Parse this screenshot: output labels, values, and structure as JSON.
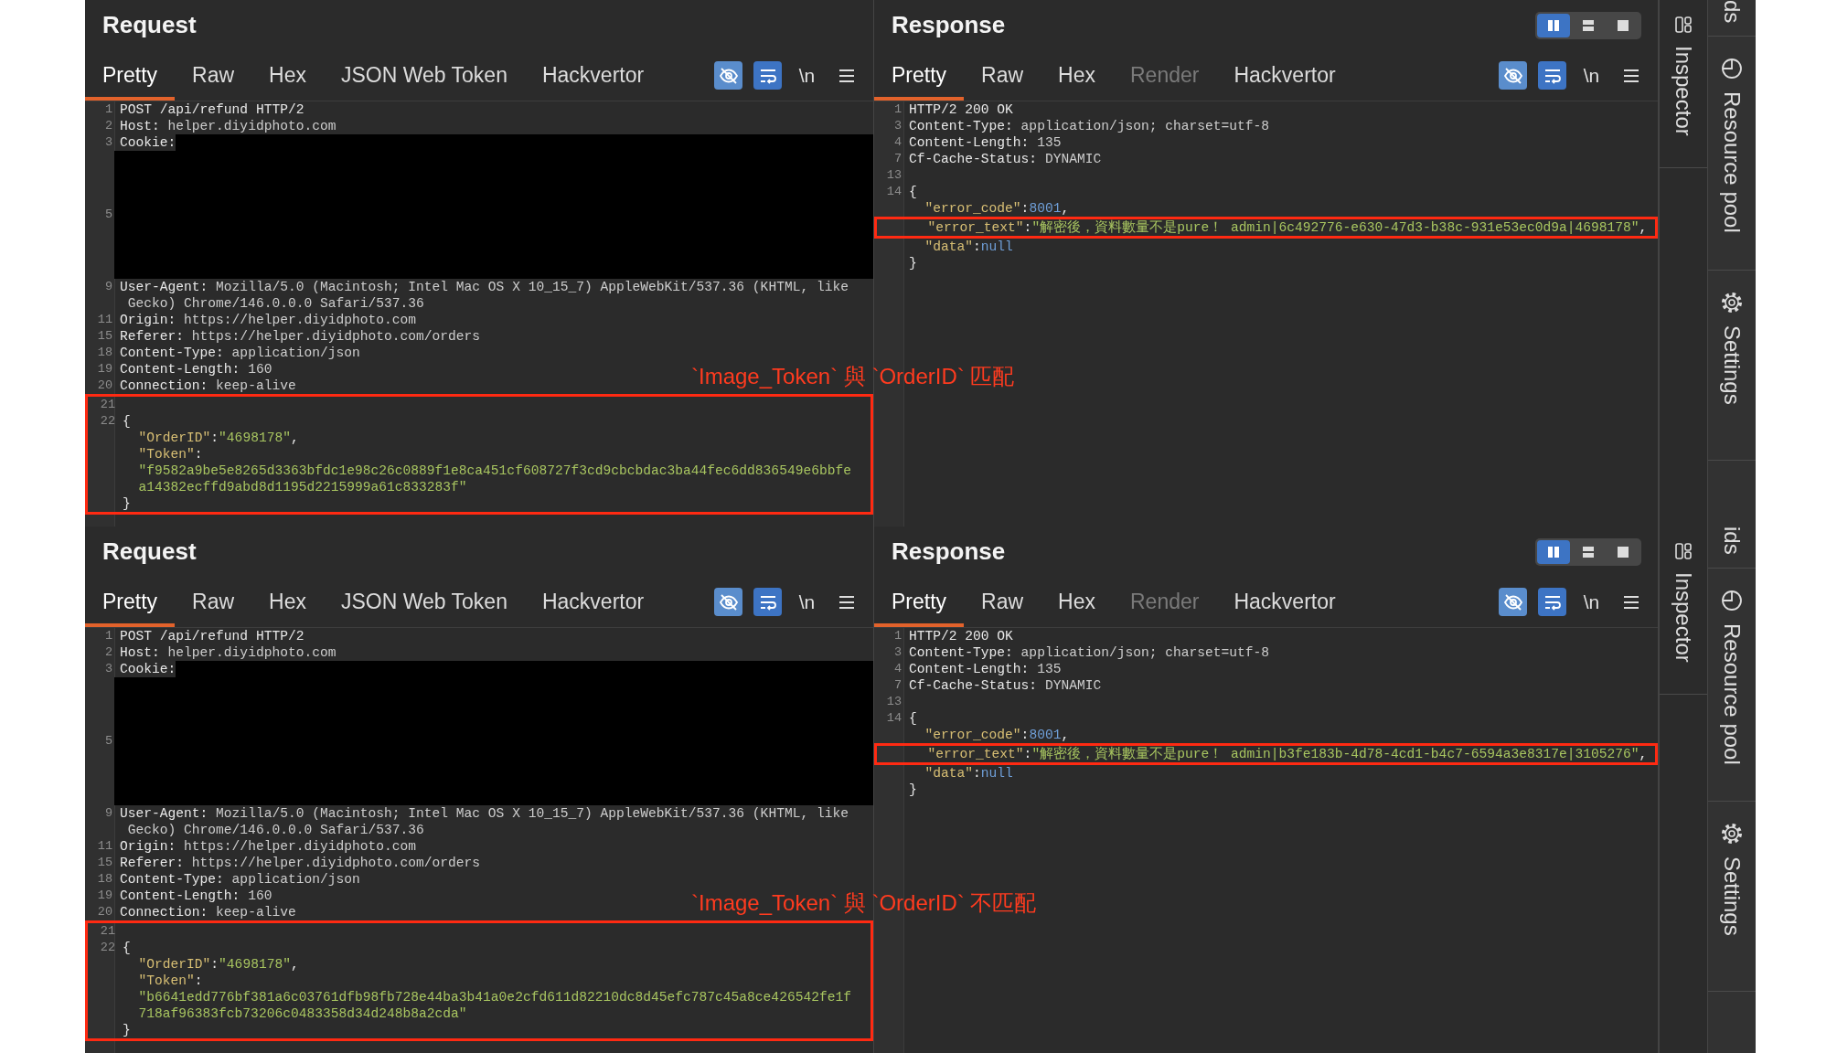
{
  "captures": [
    {
      "request": {
        "title": "Request",
        "tabs": [
          {
            "label": "Pretty",
            "selected": true,
            "disabled": false
          },
          {
            "label": "Raw",
            "selected": false,
            "disabled": false
          },
          {
            "label": "Hex",
            "selected": false,
            "disabled": false
          },
          {
            "label": "JSON Web Token",
            "selected": false,
            "disabled": false
          },
          {
            "label": "Hackvertor",
            "selected": false,
            "disabled": false
          }
        ],
        "toolbar": [
          {
            "kind": "hide",
            "on": true
          },
          {
            "kind": "wrap",
            "on": true
          },
          {
            "kind": "newline",
            "label": "\\n"
          },
          {
            "kind": "menu"
          }
        ],
        "blocks": [
          {
            "kind": "plain",
            "lines": [
              {
                "n": "1",
                "kind": "code",
                "segs": [
                  {
                    "kind": "plain",
                    "text": "POST /api/refund HTTP/2"
                  }
                ]
              },
              {
                "n": "2",
                "kind": "code",
                "segs": [
                  {
                    "kind": "name",
                    "text": "Host:"
                  },
                  {
                    "kind": "value",
                    "text": " helper.diyidphoto.com"
                  }
                ]
              },
              {
                "n": "3",
                "kind": "code-redacted",
                "segs": [
                  {
                    "kind": "name",
                    "text": "Cookie:"
                  }
                ]
              },
              {
                "n": "5",
                "kind": "redacted"
              },
              {
                "n": "9",
                "kind": "code",
                "segs": [
                  {
                    "kind": "name",
                    "text": "User-Agent:"
                  },
                  {
                    "kind": "value",
                    "text": " Mozilla/5.0 (Macintosh; Intel Mac OS X 10_15_7) AppleWebKit/537.36 (KHTML, like"
                  }
                ]
              },
              {
                "kind": "code",
                "segs": [
                  {
                    "kind": "value",
                    "text": " Gecko) Chrome/146.0.0.0 Safari/537.36"
                  }
                ]
              },
              {
                "n": "11",
                "kind": "code",
                "segs": [
                  {
                    "kind": "name",
                    "text": "Origin:"
                  },
                  {
                    "kind": "value",
                    "text": " https://helper.diyidphoto.com"
                  }
                ]
              },
              {
                "n": "15",
                "kind": "code",
                "segs": [
                  {
                    "kind": "name",
                    "text": "Referer:"
                  },
                  {
                    "kind": "value",
                    "text": " https://helper.diyidphoto.com/orders"
                  }
                ]
              },
              {
                "n": "18",
                "kind": "code",
                "segs": [
                  {
                    "kind": "name",
                    "text": "Content-Type:"
                  },
                  {
                    "kind": "value",
                    "text": " application/json"
                  }
                ]
              },
              {
                "n": "19",
                "kind": "code",
                "segs": [
                  {
                    "kind": "name",
                    "text": "Content-Length:"
                  },
                  {
                    "kind": "value",
                    "text": " 160"
                  }
                ]
              },
              {
                "n": "20",
                "kind": "code",
                "segs": [
                  {
                    "kind": "name",
                    "text": "Connection:"
                  },
                  {
                    "kind": "value",
                    "text": " keep-alive"
                  }
                ]
              }
            ]
          },
          {
            "kind": "boxed",
            "lines": [
              {
                "n": "21",
                "kind": "blank"
              },
              {
                "n": "22",
                "kind": "code",
                "segs": [
                  {
                    "kind": "punct",
                    "text": "{"
                  }
                ]
              },
              {
                "kind": "code",
                "segs": [
                  {
                    "kind": "key",
                    "text": "  \"OrderID\""
                  },
                  {
                    "kind": "punct",
                    "text": ":"
                  },
                  {
                    "kind": "string",
                    "text": "\"4698178\""
                  },
                  {
                    "kind": "punct",
                    "text": ","
                  }
                ]
              },
              {
                "kind": "code",
                "segs": [
                  {
                    "kind": "key",
                    "text": "  \"Token\""
                  },
                  {
                    "kind": "punct",
                    "text": ":"
                  }
                ]
              },
              {
                "kind": "code",
                "segs": [
                  {
                    "kind": "string",
                    "text": "  \"f9582a9be5e8265d3363bfdc1e98c26c0889f1e8ca451cf608727f3cd9cbcbdac3ba44fec6dd836549e6bbfe"
                  }
                ]
              },
              {
                "kind": "code",
                "segs": [
                  {
                    "kind": "string",
                    "text": "  a14382ecffd9abd8d1195d2215999a61c833283f\""
                  }
                ]
              },
              {
                "kind": "code",
                "segs": [
                  {
                    "kind": "punct",
                    "text": "}"
                  }
                ]
              }
            ]
          }
        ]
      },
      "response": {
        "title": "Response",
        "layout_buttons": [
          {
            "kind": "columns",
            "selected": true
          },
          {
            "kind": "rows",
            "selected": false
          },
          {
            "kind": "single",
            "selected": false
          }
        ],
        "tabs": [
          {
            "label": "Pretty",
            "selected": true,
            "disabled": false
          },
          {
            "label": "Raw",
            "selected": false,
            "disabled": false
          },
          {
            "label": "Hex",
            "selected": false,
            "disabled": false
          },
          {
            "label": "Render",
            "selected": false,
            "disabled": true
          },
          {
            "label": "Hackvertor",
            "selected": false,
            "disabled": false
          }
        ],
        "toolbar": [
          {
            "kind": "hide",
            "on": true
          },
          {
            "kind": "wrap",
            "on": true
          },
          {
            "kind": "newline",
            "label": "\\n"
          },
          {
            "kind": "menu"
          }
        ],
        "blocks": [
          {
            "kind": "plain",
            "lines": [
              {
                "n": "1",
                "kind": "code",
                "segs": [
                  {
                    "kind": "plain",
                    "text": "HTTP/2 200 OK"
                  }
                ]
              },
              {
                "n": "3",
                "kind": "code",
                "segs": [
                  {
                    "kind": "name",
                    "text": "Content-Type:"
                  },
                  {
                    "kind": "value",
                    "text": " application/json; charset=utf-8"
                  }
                ]
              },
              {
                "n": "4",
                "kind": "code",
                "segs": [
                  {
                    "kind": "name",
                    "text": "Content-Length:"
                  },
                  {
                    "kind": "value",
                    "text": " 135"
                  }
                ]
              },
              {
                "n": "7",
                "kind": "code",
                "segs": [
                  {
                    "kind": "name",
                    "text": "Cf-Cache-Status:"
                  },
                  {
                    "kind": "value",
                    "text": " DYNAMIC"
                  }
                ]
              },
              {
                "n": "13",
                "kind": "blank"
              },
              {
                "n": "14",
                "kind": "code",
                "segs": [
                  {
                    "kind": "punct",
                    "text": "{"
                  }
                ]
              },
              {
                "kind": "code",
                "segs": [
                  {
                    "kind": "key",
                    "text": "  \"error_code\""
                  },
                  {
                    "kind": "punct",
                    "text": ":"
                  },
                  {
                    "kind": "number",
                    "text": "8001"
                  },
                  {
                    "kind": "punct",
                    "text": ","
                  }
                ]
              }
            ]
          },
          {
            "kind": "boxed",
            "lines": [
              {
                "kind": "code",
                "segs": [
                  {
                    "kind": "key",
                    "text": "  \"error_text\""
                  },
                  {
                    "kind": "punct",
                    "text": ":"
                  },
                  {
                    "kind": "string",
                    "text": "\"解密後，資料數量不是pure！ admin|6c492776-e630-47d3-b38c-931e53ec0d9a|4698178\""
                  },
                  {
                    "kind": "punct",
                    "text": ","
                  }
                ]
              }
            ]
          },
          {
            "kind": "plain",
            "lines": [
              {
                "kind": "code",
                "segs": [
                  {
                    "kind": "key",
                    "text": "  \"data\""
                  },
                  {
                    "kind": "punct",
                    "text": ":"
                  },
                  {
                    "kind": "number",
                    "text": "null"
                  }
                ]
              },
              {
                "kind": "code",
                "segs": [
                  {
                    "kind": "punct",
                    "text": "}"
                  }
                ]
              }
            ]
          }
        ]
      },
      "note": "`Image_Token` 與 `OrderID` 匹配",
      "inspector_tab": {
        "label": "Inspector"
      },
      "side_tabs": [
        {
          "kind": "cut",
          "label": "ds"
        },
        {
          "kind": "resource",
          "label": "Resource pool"
        },
        {
          "kind": "settings",
          "label": "Settings"
        }
      ]
    },
    {
      "request": {
        "title": "Request",
        "tabs": [
          {
            "label": "Pretty",
            "selected": true,
            "disabled": false
          },
          {
            "label": "Raw",
            "selected": false,
            "disabled": false
          },
          {
            "label": "Hex",
            "selected": false,
            "disabled": false
          },
          {
            "label": "JSON Web Token",
            "selected": false,
            "disabled": false
          },
          {
            "label": "Hackvertor",
            "selected": false,
            "disabled": false
          }
        ],
        "toolbar": [
          {
            "kind": "hide",
            "on": true
          },
          {
            "kind": "wrap",
            "on": true
          },
          {
            "kind": "newline",
            "label": "\\n"
          },
          {
            "kind": "menu"
          }
        ],
        "blocks": [
          {
            "kind": "plain",
            "lines": [
              {
                "n": "1",
                "kind": "code",
                "segs": [
                  {
                    "kind": "plain",
                    "text": "POST /api/refund HTTP/2"
                  }
                ]
              },
              {
                "n": "2",
                "kind": "code",
                "segs": [
                  {
                    "kind": "name",
                    "text": "Host:"
                  },
                  {
                    "kind": "value",
                    "text": " helper.diyidphoto.com"
                  }
                ]
              },
              {
                "n": "3",
                "kind": "code-redacted",
                "segs": [
                  {
                    "kind": "name",
                    "text": "Cookie:"
                  }
                ]
              },
              {
                "n": "5",
                "kind": "redacted"
              },
              {
                "n": "9",
                "kind": "code",
                "segs": [
                  {
                    "kind": "name",
                    "text": "User-Agent:"
                  },
                  {
                    "kind": "value",
                    "text": " Mozilla/5.0 (Macintosh; Intel Mac OS X 10_15_7) AppleWebKit/537.36 (KHTML, like"
                  }
                ]
              },
              {
                "kind": "code",
                "segs": [
                  {
                    "kind": "value",
                    "text": " Gecko) Chrome/146.0.0.0 Safari/537.36"
                  }
                ]
              },
              {
                "n": "11",
                "kind": "code",
                "segs": [
                  {
                    "kind": "name",
                    "text": "Origin:"
                  },
                  {
                    "kind": "value",
                    "text": " https://helper.diyidphoto.com"
                  }
                ]
              },
              {
                "n": "15",
                "kind": "code",
                "segs": [
                  {
                    "kind": "name",
                    "text": "Referer:"
                  },
                  {
                    "kind": "value",
                    "text": " https://helper.diyidphoto.com/orders"
                  }
                ]
              },
              {
                "n": "18",
                "kind": "code",
                "segs": [
                  {
                    "kind": "name",
                    "text": "Content-Type:"
                  },
                  {
                    "kind": "value",
                    "text": " application/json"
                  }
                ]
              },
              {
                "n": "19",
                "kind": "code",
                "segs": [
                  {
                    "kind": "name",
                    "text": "Content-Length:"
                  },
                  {
                    "kind": "value",
                    "text": " 160"
                  }
                ]
              },
              {
                "n": "20",
                "kind": "code",
                "segs": [
                  {
                    "kind": "name",
                    "text": "Connection:"
                  },
                  {
                    "kind": "value",
                    "text": " keep-alive"
                  }
                ]
              }
            ]
          },
          {
            "kind": "boxed",
            "lines": [
              {
                "n": "21",
                "kind": "blank"
              },
              {
                "n": "22",
                "kind": "code",
                "segs": [
                  {
                    "kind": "punct",
                    "text": "{"
                  }
                ]
              },
              {
                "kind": "code",
                "segs": [
                  {
                    "kind": "key",
                    "text": "  \"OrderID\""
                  },
                  {
                    "kind": "punct",
                    "text": ":"
                  },
                  {
                    "kind": "string",
                    "text": "\"4698178\""
                  },
                  {
                    "kind": "punct",
                    "text": ","
                  }
                ]
              },
              {
                "kind": "code",
                "segs": [
                  {
                    "kind": "key",
                    "text": "  \"Token\""
                  },
                  {
                    "kind": "punct",
                    "text": ":"
                  }
                ]
              },
              {
                "kind": "code",
                "segs": [
                  {
                    "kind": "string",
                    "text": "  \"b6641edd776bf381a6c03761dfb98fb728e44ba3b41a0e2cfd611d82210dc8d45efc787c45a8ce426542fe1f"
                  }
                ]
              },
              {
                "kind": "code",
                "segs": [
                  {
                    "kind": "string",
                    "text": "  718af96383fcb73206c0483358d34d248b8a2cda\""
                  }
                ]
              },
              {
                "kind": "code",
                "segs": [
                  {
                    "kind": "punct",
                    "text": "}"
                  }
                ]
              }
            ]
          }
        ]
      },
      "response": {
        "title": "Response",
        "layout_buttons": [
          {
            "kind": "columns",
            "selected": true
          },
          {
            "kind": "rows",
            "selected": false
          },
          {
            "kind": "single",
            "selected": false
          }
        ],
        "tabs": [
          {
            "label": "Pretty",
            "selected": true,
            "disabled": false
          },
          {
            "label": "Raw",
            "selected": false,
            "disabled": false
          },
          {
            "label": "Hex",
            "selected": false,
            "disabled": false
          },
          {
            "label": "Render",
            "selected": false,
            "disabled": true
          },
          {
            "label": "Hackvertor",
            "selected": false,
            "disabled": false
          }
        ],
        "toolbar": [
          {
            "kind": "hide",
            "on": true
          },
          {
            "kind": "wrap",
            "on": true
          },
          {
            "kind": "newline",
            "label": "\\n"
          },
          {
            "kind": "menu"
          }
        ],
        "blocks": [
          {
            "kind": "plain",
            "lines": [
              {
                "n": "1",
                "kind": "code",
                "segs": [
                  {
                    "kind": "plain",
                    "text": "HTTP/2 200 OK"
                  }
                ]
              },
              {
                "n": "3",
                "kind": "code",
                "segs": [
                  {
                    "kind": "name",
                    "text": "Content-Type:"
                  },
                  {
                    "kind": "value",
                    "text": " application/json; charset=utf-8"
                  }
                ]
              },
              {
                "n": "4",
                "kind": "code",
                "segs": [
                  {
                    "kind": "name",
                    "text": "Content-Length:"
                  },
                  {
                    "kind": "value",
                    "text": " 135"
                  }
                ]
              },
              {
                "n": "7",
                "kind": "code",
                "segs": [
                  {
                    "kind": "name",
                    "text": "Cf-Cache-Status:"
                  },
                  {
                    "kind": "value",
                    "text": " DYNAMIC"
                  }
                ]
              },
              {
                "n": "13",
                "kind": "blank"
              },
              {
                "n": "14",
                "kind": "code",
                "segs": [
                  {
                    "kind": "punct",
                    "text": "{"
                  }
                ]
              },
              {
                "kind": "code",
                "segs": [
                  {
                    "kind": "key",
                    "text": "  \"error_code\""
                  },
                  {
                    "kind": "punct",
                    "text": ":"
                  },
                  {
                    "kind": "number",
                    "text": "8001"
                  },
                  {
                    "kind": "punct",
                    "text": ","
                  }
                ]
              }
            ]
          },
          {
            "kind": "boxed",
            "lines": [
              {
                "kind": "code",
                "segs": [
                  {
                    "kind": "key",
                    "text": "  \"error_text\""
                  },
                  {
                    "kind": "punct",
                    "text": ":"
                  },
                  {
                    "kind": "string",
                    "text": "\"解密後，資料數量不是pure！ admin|b3fe183b-4d78-4cd1-b4c7-6594a3e8317e|3105276\""
                  },
                  {
                    "kind": "punct",
                    "text": ","
                  }
                ]
              }
            ]
          },
          {
            "kind": "plain",
            "lines": [
              {
                "kind": "code",
                "segs": [
                  {
                    "kind": "key",
                    "text": "  \"data\""
                  },
                  {
                    "kind": "punct",
                    "text": ":"
                  },
                  {
                    "kind": "number",
                    "text": "null"
                  }
                ]
              },
              {
                "kind": "code",
                "segs": [
                  {
                    "kind": "punct",
                    "text": "}"
                  }
                ]
              }
            ]
          }
        ]
      },
      "note": "`Image_Token` 與 `OrderID` 不匹配",
      "inspector_tab": {
        "label": "Inspector"
      },
      "side_tabs": [
        {
          "kind": "cut",
          "label": "ids"
        },
        {
          "kind": "resource",
          "label": "Resource pool"
        },
        {
          "kind": "settings",
          "label": "Settings"
        }
      ]
    }
  ]
}
